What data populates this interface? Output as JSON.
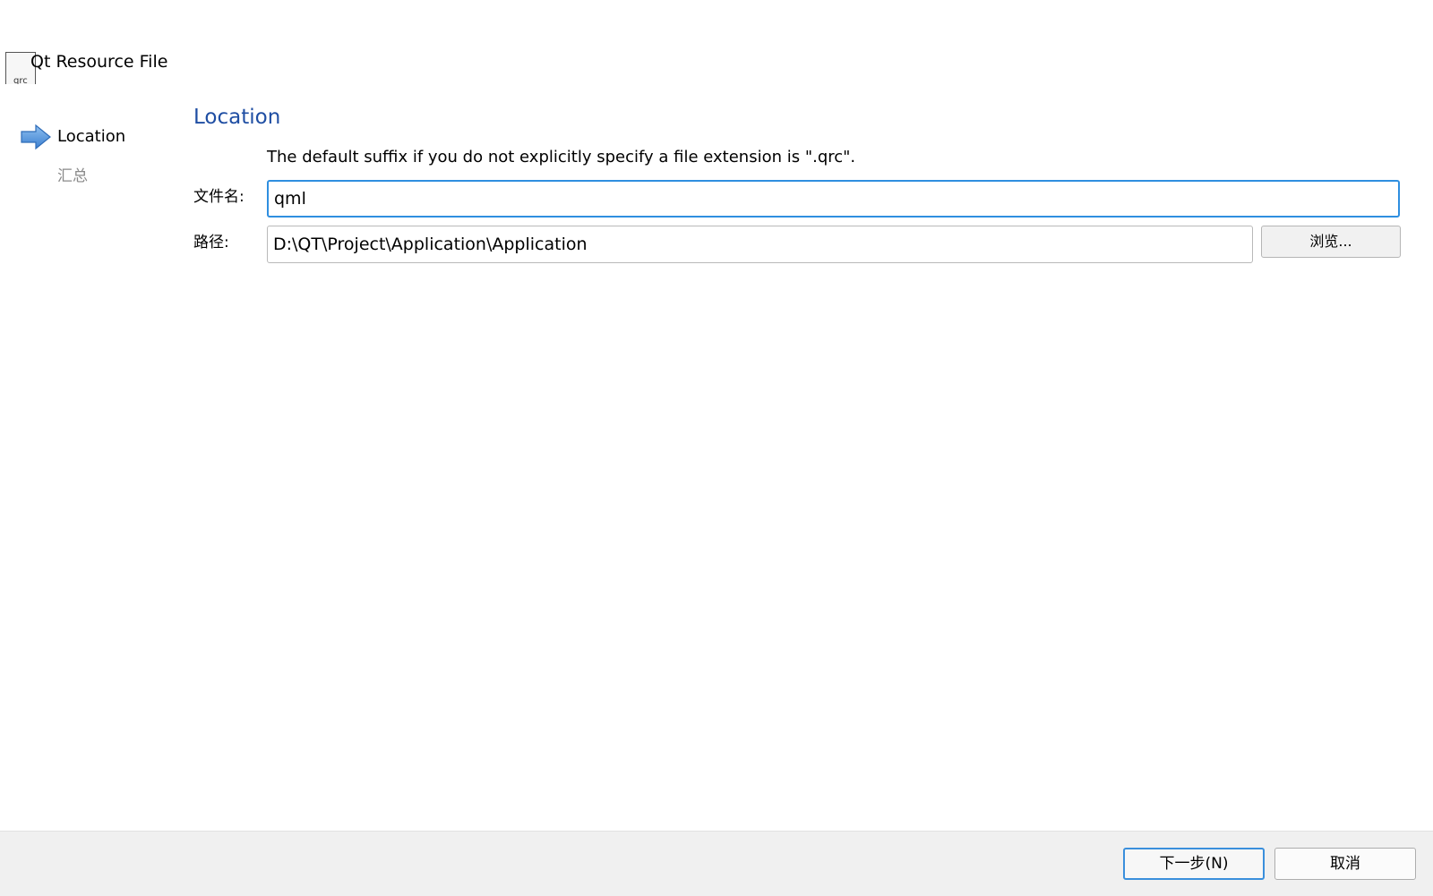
{
  "header": {
    "file_icon_label": "qrc",
    "title": "Qt Resource File"
  },
  "sidebar": {
    "steps": [
      {
        "label": "Location",
        "current": true
      },
      {
        "label": "汇总",
        "current": false
      }
    ]
  },
  "main": {
    "title": "Location",
    "hint": "The default suffix if you do not explicitly specify a file extension is \".qrc\".",
    "filename_label": "文件名:",
    "filename_value": "qml",
    "path_label": "路径:",
    "path_value": "D:\\QT\\Project\\Application\\Application",
    "browse_label": "浏览..."
  },
  "footer": {
    "next_label": "下一步(N)",
    "cancel_label": "取消"
  },
  "colors": {
    "accent": "#2f8fe0",
    "title": "#1f4ea3",
    "footer_bg": "#f0f0f0"
  },
  "icons": {
    "file": "qrc-file-icon",
    "current_step": "arrow-right-icon"
  }
}
